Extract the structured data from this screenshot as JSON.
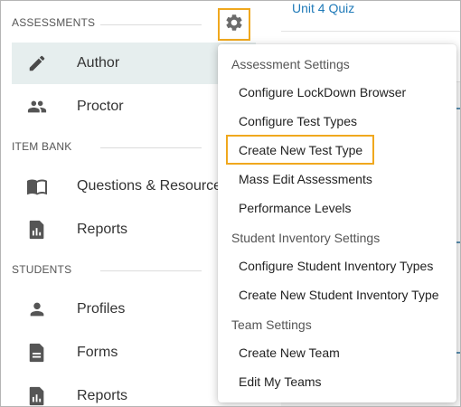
{
  "sidebar": {
    "sections": [
      {
        "label": "ASSESSMENTS",
        "items": [
          {
            "label": "Author",
            "icon": "pencil-icon",
            "active": true
          },
          {
            "label": "Proctor",
            "icon": "people-icon"
          }
        ]
      },
      {
        "label": "ITEM BANK",
        "items": [
          {
            "label": "Questions & Resources",
            "icon": "book-icon"
          },
          {
            "label": "Reports",
            "icon": "report-icon"
          }
        ]
      },
      {
        "label": "STUDENTS",
        "items": [
          {
            "label": "Profiles",
            "icon": "person-icon"
          },
          {
            "label": "Forms",
            "icon": "document-icon"
          },
          {
            "label": "Reports",
            "icon": "report-icon"
          }
        ]
      }
    ]
  },
  "background": {
    "link_text": "Unit 4 Quiz"
  },
  "settings_menu": {
    "groups": [
      {
        "header": "Assessment Settings",
        "items": [
          "Configure LockDown Browser",
          "Configure Test Types",
          "Create New Test Type",
          "Mass Edit Assessments",
          "Performance Levels"
        ]
      },
      {
        "header": "Student Inventory Settings",
        "items": [
          "Configure Student Inventory Types",
          "Create New Student Inventory Type"
        ]
      },
      {
        "header": "Team Settings",
        "items": [
          "Create New Team",
          "Edit My Teams"
        ]
      }
    ]
  },
  "colors": {
    "highlight": "#f0a81e",
    "active_bg": "#e6eeee",
    "icon": "#555555",
    "link": "#1f7ab8"
  }
}
